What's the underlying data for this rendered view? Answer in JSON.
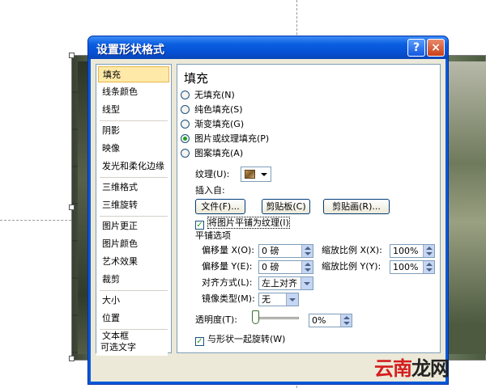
{
  "dialog": {
    "title": "设置形状格式",
    "help_label": "?",
    "close_label": "×"
  },
  "nav": {
    "items": [
      {
        "label": "填充",
        "active": true
      },
      {
        "label": "线条颜色"
      },
      {
        "label": "线型"
      },
      {
        "label": "阴影"
      },
      {
        "label": "映像"
      },
      {
        "label": "发光和柔化边缘"
      },
      {
        "label": "三维格式"
      },
      {
        "label": "三维旋转"
      },
      {
        "label": "图片更正"
      },
      {
        "label": "图片颜色"
      },
      {
        "label": "艺术效果"
      },
      {
        "label": "裁剪"
      },
      {
        "label": "大小"
      },
      {
        "label": "位置"
      },
      {
        "label": "文本框"
      },
      {
        "label": "可选文字"
      }
    ]
  },
  "panel": {
    "title": "填充",
    "fill_options": [
      {
        "label": "无填充(N)",
        "selected": false
      },
      {
        "label": "纯色填充(S)",
        "selected": false
      },
      {
        "label": "渐变填充(G)",
        "selected": false
      },
      {
        "label": "图片或纹理填充(P)",
        "selected": true
      },
      {
        "label": "图案填充(A)",
        "selected": false
      }
    ],
    "texture_label": "纹理(U):",
    "texture_icon": "texture-swatch-icon",
    "insert_from_label": "插入自:",
    "buttons": {
      "file": "文件(F)...",
      "clipboard": "剪贴板(C)",
      "clipart": "剪贴画(R)..."
    },
    "tile_checkbox": {
      "label": "将图片平铺为纹理(I)",
      "checked": true
    },
    "tile_options_label": "平铺选项",
    "offset_x_label": "偏移量 X(O):",
    "offset_x_value": "0 磅",
    "scale_x_label": "缩放比例 X(X):",
    "scale_x_value": "100%",
    "offset_y_label": "偏移量 Y(E):",
    "offset_y_value": "0 磅",
    "scale_y_label": "缩放比例 Y(Y):",
    "scale_y_value": "100%",
    "alignment_label": "对齐方式(L):",
    "alignment_value": "左上对齐",
    "mirror_label": "镜像类型(M):",
    "mirror_value": "无",
    "transparency_label": "透明度(T):",
    "transparency_value": "0%",
    "transparency_level": 0,
    "rotate_checkbox": {
      "label": "与形状一起旋转(W)",
      "checked": true
    }
  },
  "watermark": {
    "part1": "云南",
    "part2": "龙网"
  },
  "colors": {
    "title_bar": "#0a5ee0",
    "dialog_bg": "#ece9d8",
    "nav_active": "#ffe9a8",
    "watermark": "#d41e1e"
  }
}
